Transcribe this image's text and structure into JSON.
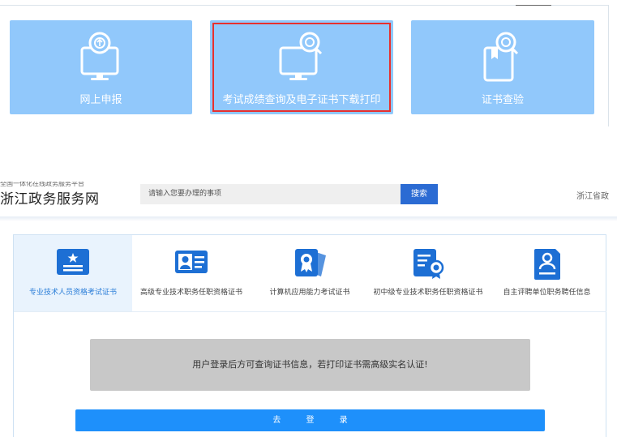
{
  "top_tiles": [
    {
      "label": "网上申报",
      "icon": "monitor-upload-icon"
    },
    {
      "label": "考试成绩查询及电子证书下载打印",
      "icon": "monitor-search-icon",
      "highlighted": true
    },
    {
      "label": "证书查验",
      "icon": "certificate-search-icon"
    }
  ],
  "header": {
    "slogan": "全国一体化在线政务服务平台",
    "site_title": "浙江政务服务网",
    "search_placeholder": "请输入您要办理的事项",
    "search_button": "搜索",
    "region": "浙江省政"
  },
  "categories": [
    {
      "label": "专业技术人员资格考试证书",
      "icon": "certificate-card-icon",
      "active": true
    },
    {
      "label": "高级专业技术职务任职资格证书",
      "icon": "id-card-icon",
      "active": false
    },
    {
      "label": "计算机应用能力考试证书",
      "icon": "award-badge-icon",
      "active": false
    },
    {
      "label": "初中级专业技术职务任职资格证书",
      "icon": "document-seal-icon",
      "active": false
    },
    {
      "label": "自主评聘单位职务聘任信息",
      "icon": "person-document-icon",
      "active": false
    }
  ],
  "notice": "用户登录后方可查询证书信息，若打印证书需高级实名认证!",
  "login_button": "去  登  录",
  "colors": {
    "tile": "#91c8fb",
    "highlight_border": "#e8302e",
    "primary_blue": "#1e90fb",
    "search_button": "#2b6bd3",
    "icon_blue": "#1d6fd4"
  }
}
